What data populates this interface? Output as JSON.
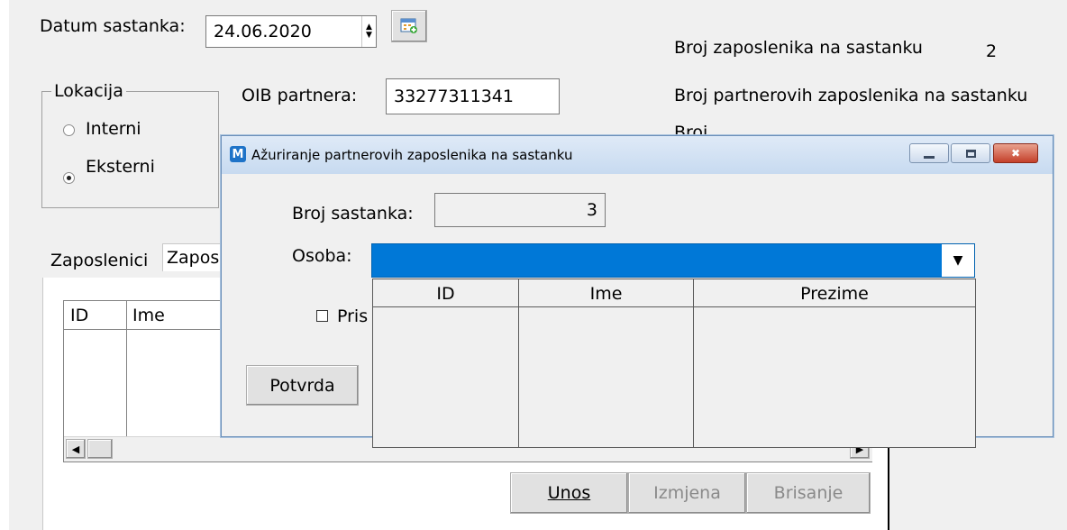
{
  "form": {
    "datum_label": "Datum sastanka:",
    "datum_value": "24.06.2020",
    "broj_zaposlenika_label": "Broj zaposlenika na sastanku",
    "broj_zaposlenika_value": "2",
    "broj_partnerovih_label": "Broj partnerovih zaposlenika na sastanku",
    "broj_third_partial": "Broj ...",
    "lokacija_title": "Lokacija",
    "interni_label": "Interni",
    "eksterni_label": "Eksterni",
    "oib_label": "OIB partnera:",
    "oib_value": "33277311341",
    "tabs": [
      "Zaposlenici",
      "Zapos"
    ],
    "grid_headers": [
      "ID",
      "Ime"
    ],
    "buttons": {
      "unos": "Unos",
      "izmjena": "Izmjena",
      "brisanje": "Brisanje"
    }
  },
  "dialog": {
    "app_icon_letter": "M",
    "title": "Ažuriranje partnerovih zaposlenika na sastanku",
    "broj_sastanka_label": "Broj sastanka:",
    "broj_sastanka_value": "3",
    "osoba_label": "Osoba:",
    "checkbox_label_partial": "Pris",
    "potvrda_label": "Potvrda",
    "dropdown_columns": [
      "ID",
      "Ime",
      "Prezime"
    ]
  },
  "icons": {
    "calendar": "calendar-add-icon",
    "minimize": "minimize-icon",
    "maximize": "maximize-icon",
    "close": "close-icon",
    "dropdown": "chevron-down-icon"
  },
  "colors": {
    "selection": "#0078d7",
    "close_button": "#c4402a",
    "titlebar": "#c7daf0"
  }
}
